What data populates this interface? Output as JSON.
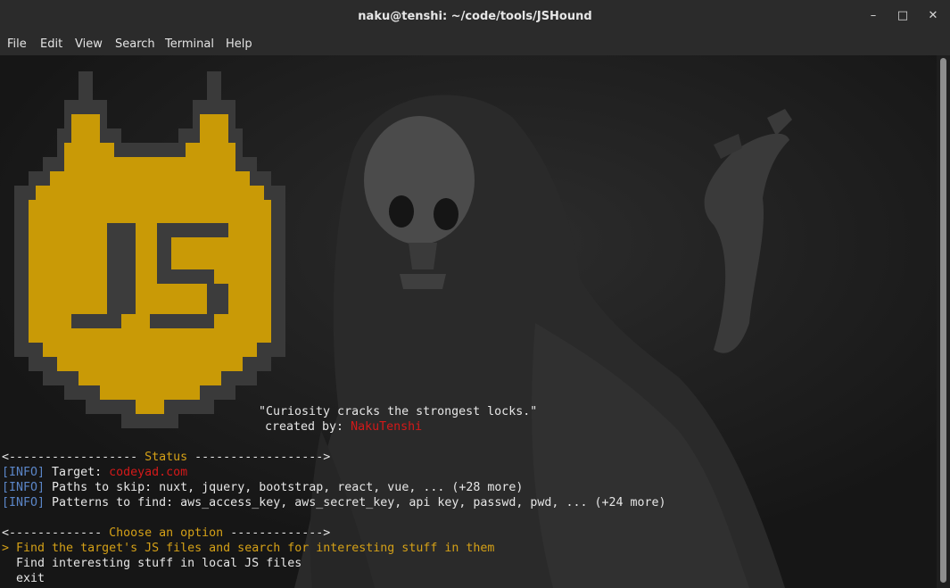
{
  "window": {
    "title": "naku@tenshi: ~/code/tools/JSHound",
    "minimize_glyph": "–",
    "maximize_glyph": "□",
    "close_glyph": "✕"
  },
  "menu": {
    "items": [
      "File",
      "Edit",
      "View",
      "Search",
      "Terminal",
      "Help"
    ]
  },
  "logo": {
    "text": "JS",
    "fill_color": "#c99a06",
    "outline_color": "#3a3a3a"
  },
  "banner": {
    "quote": "\"Curiosity cracks the strongest locks.\"",
    "created_by_label": "created by: ",
    "author": "NakuTenshi"
  },
  "status": {
    "left_rule": "<------------------ ",
    "title": "Status",
    "right_rule": " ------------------>",
    "lines": [
      {
        "tag": "[INFO]",
        "label": " Target: ",
        "value": "codeyad.com",
        "value_color": "red"
      },
      {
        "tag": "[INFO]",
        "label": " Paths to skip: nuxt, jquery, bootstrap, react, vue, ... (+28 more)",
        "value": "",
        "value_color": "white"
      },
      {
        "tag": "[INFO]",
        "label": " Patterns to find: aws_access_key, aws_secret_key, api key, passwd, pwd, ... (+24 more)",
        "value": "",
        "value_color": "white"
      }
    ]
  },
  "menu_options": {
    "left_rule": "<------------- ",
    "title": "Choose an option",
    "right_rule": " ------------->",
    "selector": "> ",
    "options": [
      "Find the target's JS files and search for interesting stuff in them",
      "Find interesting stuff in local JS files",
      "exit"
    ],
    "selected_index": 0
  }
}
